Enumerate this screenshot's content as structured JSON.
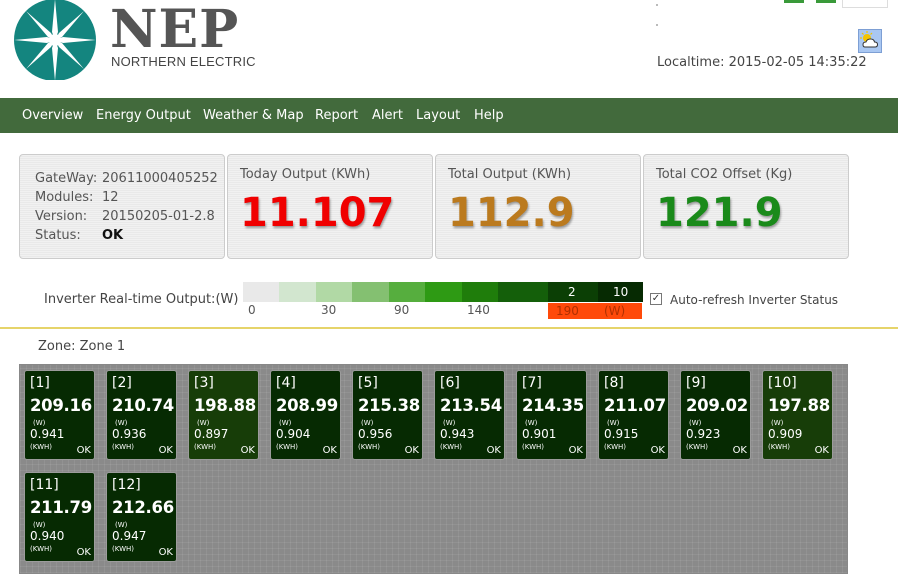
{
  "header": {
    "brand_name": "NEP",
    "brand_sub": "NORTHERN ELECTRIC",
    "localtime": "Localtime: 2015-02-05 14:35:22",
    "weather_icon": "partly-cloudy-icon"
  },
  "nav": [
    "Overview",
    "Energy Output",
    "Weather & Map",
    "Report",
    "Alert",
    "Layout",
    "Help"
  ],
  "gateway": {
    "rows": [
      {
        "label": "GateWay:",
        "value": "20611000405252"
      },
      {
        "label": "Modules:",
        "value": "12"
      },
      {
        "label": "Version:",
        "value": "20150205-01-2.8"
      },
      {
        "label": "Status:",
        "value": "OK"
      }
    ]
  },
  "stats": [
    {
      "title": "Today Output (KWh)",
      "value": "11.107",
      "color": "#f00000"
    },
    {
      "title": "Total Output (KWh)",
      "value": "112.9",
      "color": "#bb7a1e"
    },
    {
      "title": "Total CO2 Offset (Kg)",
      "value": "121.9",
      "color": "#1a8a1a"
    }
  ],
  "legend": {
    "label": "Inverter Real-time Output:(W)",
    "ticks": [
      "0",
      "30",
      "90",
      "140"
    ],
    "count_low": "2",
    "count_high": "10",
    "range_low": "190",
    "range_unit": "(W)",
    "colors": [
      "#e9e9e9",
      "#d2e6cf",
      "#b1d9a5",
      "#84c071",
      "#56ae3e",
      "#2e9a14",
      "#1f7d0b",
      "#145f0a",
      "#0b3f05",
      "#062a02"
    ]
  },
  "auto_refresh": {
    "label": "Auto-refresh Inverter Status",
    "checked": true
  },
  "zone": {
    "label": "Zone: Zone 1"
  },
  "tiles": [
    {
      "index": "[1]",
      "watts": "209.16",
      "w_unit": "(W)",
      "kwh": "0.941",
      "kwh_unit": "(KWH)",
      "status": "OK"
    },
    {
      "index": "[2]",
      "watts": "210.74",
      "w_unit": "(W)",
      "kwh": "0.936",
      "kwh_unit": "(KWH)",
      "status": "OK"
    },
    {
      "index": "[3]",
      "watts": "198.88",
      "w_unit": "(W)",
      "kwh": "0.897",
      "kwh_unit": "(KWH)",
      "status": "OK"
    },
    {
      "index": "[4]",
      "watts": "208.99",
      "w_unit": "(W)",
      "kwh": "0.904",
      "kwh_unit": "(KWH)",
      "status": "OK"
    },
    {
      "index": "[5]",
      "watts": "215.38",
      "w_unit": "(W)",
      "kwh": "0.956",
      "kwh_unit": "(KWH)",
      "status": "OK"
    },
    {
      "index": "[6]",
      "watts": "213.54",
      "w_unit": "(W)",
      "kwh": "0.943",
      "kwh_unit": "(KWH)",
      "status": "OK"
    },
    {
      "index": "[7]",
      "watts": "214.35",
      "w_unit": "(W)",
      "kwh": "0.901",
      "kwh_unit": "(KWH)",
      "status": "OK"
    },
    {
      "index": "[8]",
      "watts": "211.07",
      "w_unit": "(W)",
      "kwh": "0.915",
      "kwh_unit": "(KWH)",
      "status": "OK"
    },
    {
      "index": "[9]",
      "watts": "209.02",
      "w_unit": "(W)",
      "kwh": "0.923",
      "kwh_unit": "(KWH)",
      "status": "OK"
    },
    {
      "index": "[10]",
      "watts": "197.88",
      "w_unit": "(W)",
      "kwh": "0.909",
      "kwh_unit": "(KWH)",
      "status": "OK"
    },
    {
      "index": "[11]",
      "watts": "211.79",
      "w_unit": "(W)",
      "kwh": "0.940",
      "kwh_unit": "(KWH)",
      "status": "OK"
    },
    {
      "index": "[12]",
      "watts": "212.66",
      "w_unit": "(W)",
      "kwh": "0.947",
      "kwh_unit": "(KWH)",
      "status": "OK"
    }
  ]
}
